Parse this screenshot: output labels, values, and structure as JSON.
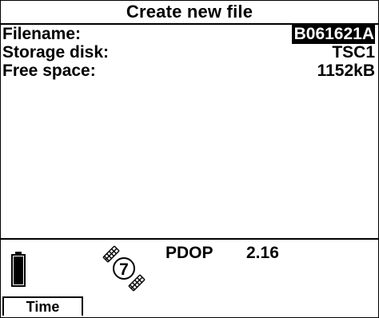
{
  "title": "Create new file",
  "fields": {
    "filename": {
      "label": "Filename:",
      "value": "B061621A"
    },
    "storage_disk": {
      "label": "Storage disk:",
      "value": "TSC1"
    },
    "free_space": {
      "label": "Free space:",
      "value": "1152kB"
    }
  },
  "status": {
    "battery_icon": "battery-icon",
    "satellite_count": "7",
    "satellite_icon": "satellite-icon",
    "pdop_label": "PDOP",
    "pdop_value": "2.16"
  },
  "softkeys": {
    "time_label": "Time"
  }
}
